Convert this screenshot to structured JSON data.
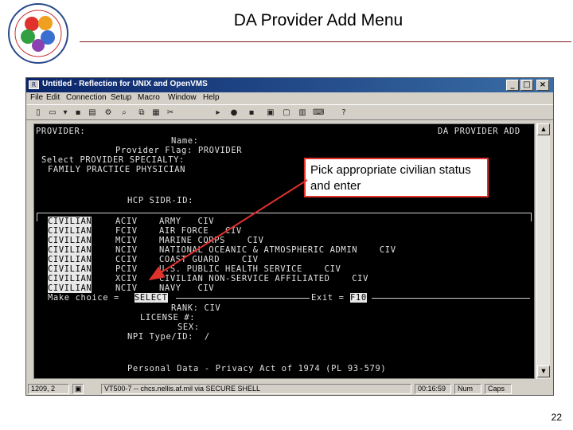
{
  "slide": {
    "title": "DA Provider Add Menu",
    "page_number": "22"
  },
  "window": {
    "title": "Untitled - Reflection for UNIX and OpenVMS",
    "controls": [
      "_",
      "□",
      "×"
    ]
  },
  "menu": [
    "File",
    "Edit",
    "Connection",
    "Setup",
    "Macro",
    "Window",
    "Help"
  ],
  "toolbar_icons": [
    "new-file-icon",
    "open-folder-icon",
    "dropdown-icon",
    "save-icon",
    "print-icon",
    "settings-icon",
    "find-icon",
    "copy-icon",
    "paste-icon",
    "cut-icon",
    "play-icon",
    "record-icon",
    "stop-icon",
    "terminal-icon",
    "chat-icon",
    "display-icon",
    "keyboard-icon",
    "help-icon"
  ],
  "terminal": {
    "header_left": "PROVIDER:",
    "header_right": "DA PROVIDER ADD",
    "name_label": "Name:",
    "provider_flag_line": "Provider Flag: PROVIDER",
    "select_specialty": "Select PROVIDER SPECIALTY:",
    "specialty_value": "FAMILY PRACTICE PHYSICIAN",
    "hcp_label": "HCP SIDR-ID:",
    "status_rows": [
      {
        "status": "CIVILIAN",
        "code": "ACIV",
        "desc": "ARMY   CIV"
      },
      {
        "status": "CIVILIAN",
        "code": "FCIV",
        "desc": "AIR FORCE   CIV"
      },
      {
        "status": "CIVILIAN",
        "code": "MCIV",
        "desc": "MARINE CORPS    CIV"
      },
      {
        "status": "CIVILIAN",
        "code": "NCIV",
        "desc": "NATIONAL OCEANIC & ATMOSPHERIC ADMIN    CIV"
      },
      {
        "status": "CIVILIAN",
        "code": "CCIV",
        "desc": "COAST GUARD    CIV"
      },
      {
        "status": "CIVILIAN",
        "code": "PCIV",
        "desc": "U.S. PUBLIC HEALTH SERVICE    CIV"
      },
      {
        "status": "CIVILIAN",
        "code": "XCIV",
        "desc": "CIVILIAN NON-SERVICE AFFILIATED    CIV"
      },
      {
        "status": "CIVILIAN",
        "code": "NCIV",
        "desc": "NAVY   CIV"
      }
    ],
    "make_choice_label": "Make choice =",
    "make_choice_value": "SELECT",
    "exit_label": "Exit =",
    "exit_key": "F10",
    "rank_line": "RANK: CIV",
    "license_label": "LICENSE #:",
    "sex_label": "SEX:",
    "npi_line": "NPI Type/ID:  /",
    "privacy_line": "Personal Data - Privacy Act of 1974 (PL 93-579)"
  },
  "statusbar": {
    "position": "1209, 2",
    "session": "VT500-7 -- chcs.nellis.af.mil via SECURE SHELL",
    "time": "00:16:59",
    "num": "Num",
    "caps": "Caps"
  },
  "callout": {
    "text": "Pick appropriate civilian status and enter",
    "border_color": "#e0312d"
  },
  "colors": {
    "terminal_bg": "#000000",
    "terminal_text": "#e0e0e0",
    "titlebar": "#0a246a",
    "accent_red": "#e0312d"
  }
}
